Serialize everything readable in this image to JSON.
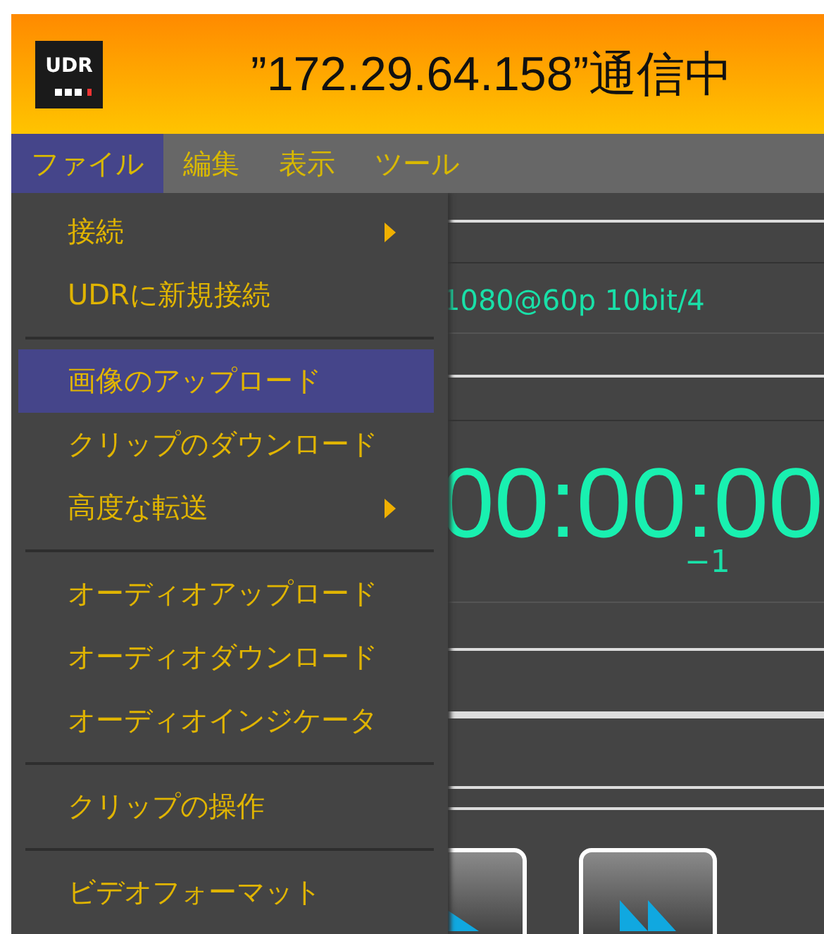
{
  "window": {
    "logo": "UDR",
    "title": "”172.29.64.158”通信中"
  },
  "menubar": [
    {
      "label": "ファイル",
      "selected": true
    },
    {
      "label": "編集",
      "selected": false
    },
    {
      "label": "表示",
      "selected": false
    },
    {
      "label": "ツール",
      "selected": false
    }
  ],
  "file_menu": {
    "groups": [
      [
        {
          "label": "接続",
          "submenu": true,
          "selected": false
        },
        {
          "label": "UDRに新規接続",
          "submenu": false,
          "selected": false
        }
      ],
      [
        {
          "label": "画像のアップロード",
          "submenu": false,
          "selected": true
        },
        {
          "label": "クリップのダウンロード",
          "submenu": false,
          "selected": false
        },
        {
          "label": "高度な転送",
          "submenu": true,
          "selected": false
        }
      ],
      [
        {
          "label": "オーディオアップロード",
          "submenu": false,
          "selected": false
        },
        {
          "label": "オーディオダウンロード",
          "submenu": false,
          "selected": false
        },
        {
          "label": "オーディオインジケータ",
          "submenu": false,
          "selected": false
        }
      ],
      [
        {
          "label": "クリップの操作",
          "submenu": false,
          "selected": false
        }
      ],
      [
        {
          "label": "ビデオフォーマット",
          "submenu": false,
          "selected": false
        }
      ]
    ]
  },
  "status": {
    "format": "1080@60p 10bit/4",
    "timecode": "00:00:00",
    "offset": "−1"
  },
  "transport": [
    {
      "kind": "play"
    },
    {
      "kind": "fast_forward"
    }
  ]
}
